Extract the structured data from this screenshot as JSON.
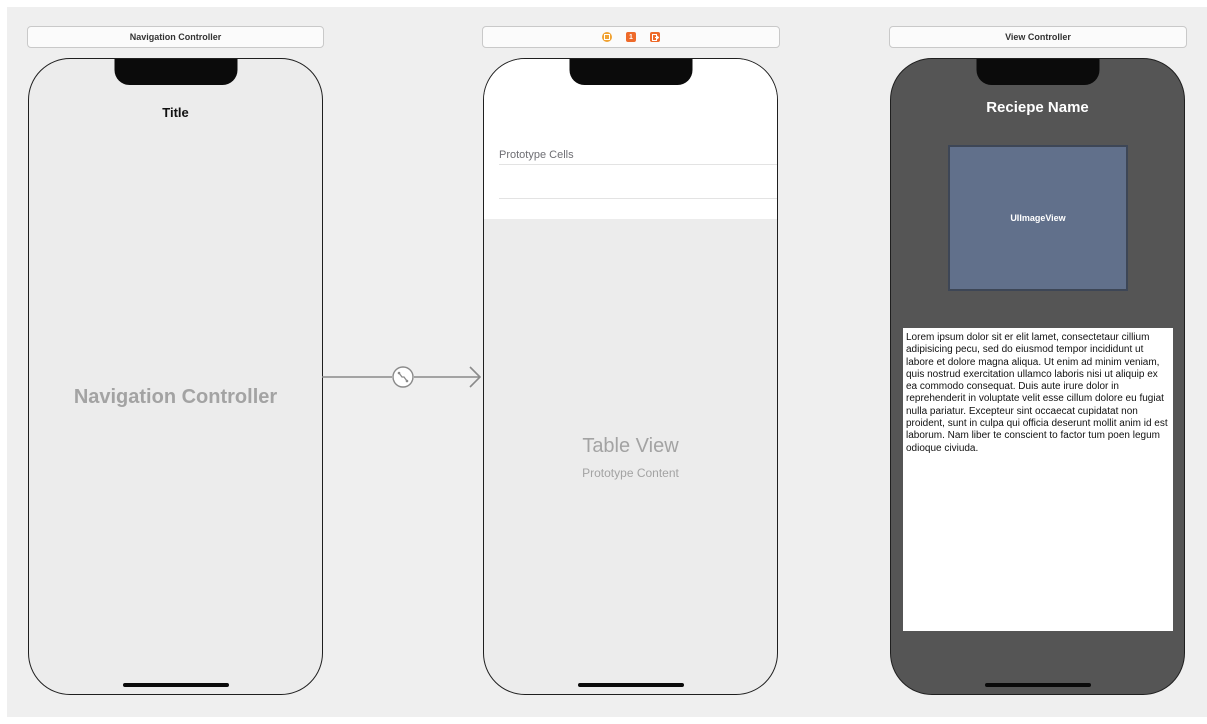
{
  "nav_scene": {
    "header": "Navigation Controller",
    "bar_title": "Title",
    "placeholder": "Navigation Controller"
  },
  "table_scene": {
    "dock_icons": [
      "view-controller-icon",
      "first-responder-icon",
      "exit-icon"
    ],
    "dock_icon_glyph_responder": "1",
    "section_label": "Prototype Cells",
    "placeholder_title": "Table View",
    "placeholder_subtitle": "Prototype Content"
  },
  "detail_scene": {
    "header": "View Controller",
    "title": "Reciepe Name",
    "image_view_label": "UIImageView",
    "body_text": "Lorem ipsum dolor sit er elit lamet, consectetaur cillium adipisicing pecu, sed do eiusmod tempor incididunt ut labore et dolore magna aliqua. Ut enim ad minim veniam, quis nostrud exercitation ullamco laboris nisi ut aliquip ex ea commodo consequat. Duis aute irure dolor in reprehenderit in voluptate velit esse cillum dolore eu fugiat nulla pariatur. Excepteur sint occaecat cupidatat non proident, sunt in culpa qui officia deserunt mollit anim id est laborum. Nam liber te conscient to factor tum poen legum odioque civiuda."
  },
  "colors": {
    "canvas": "#efefef",
    "dark_view": "#555555",
    "image_view": "#61708b",
    "dock_orange": "#f0a232",
    "dock_red": "#ee6a2a"
  }
}
